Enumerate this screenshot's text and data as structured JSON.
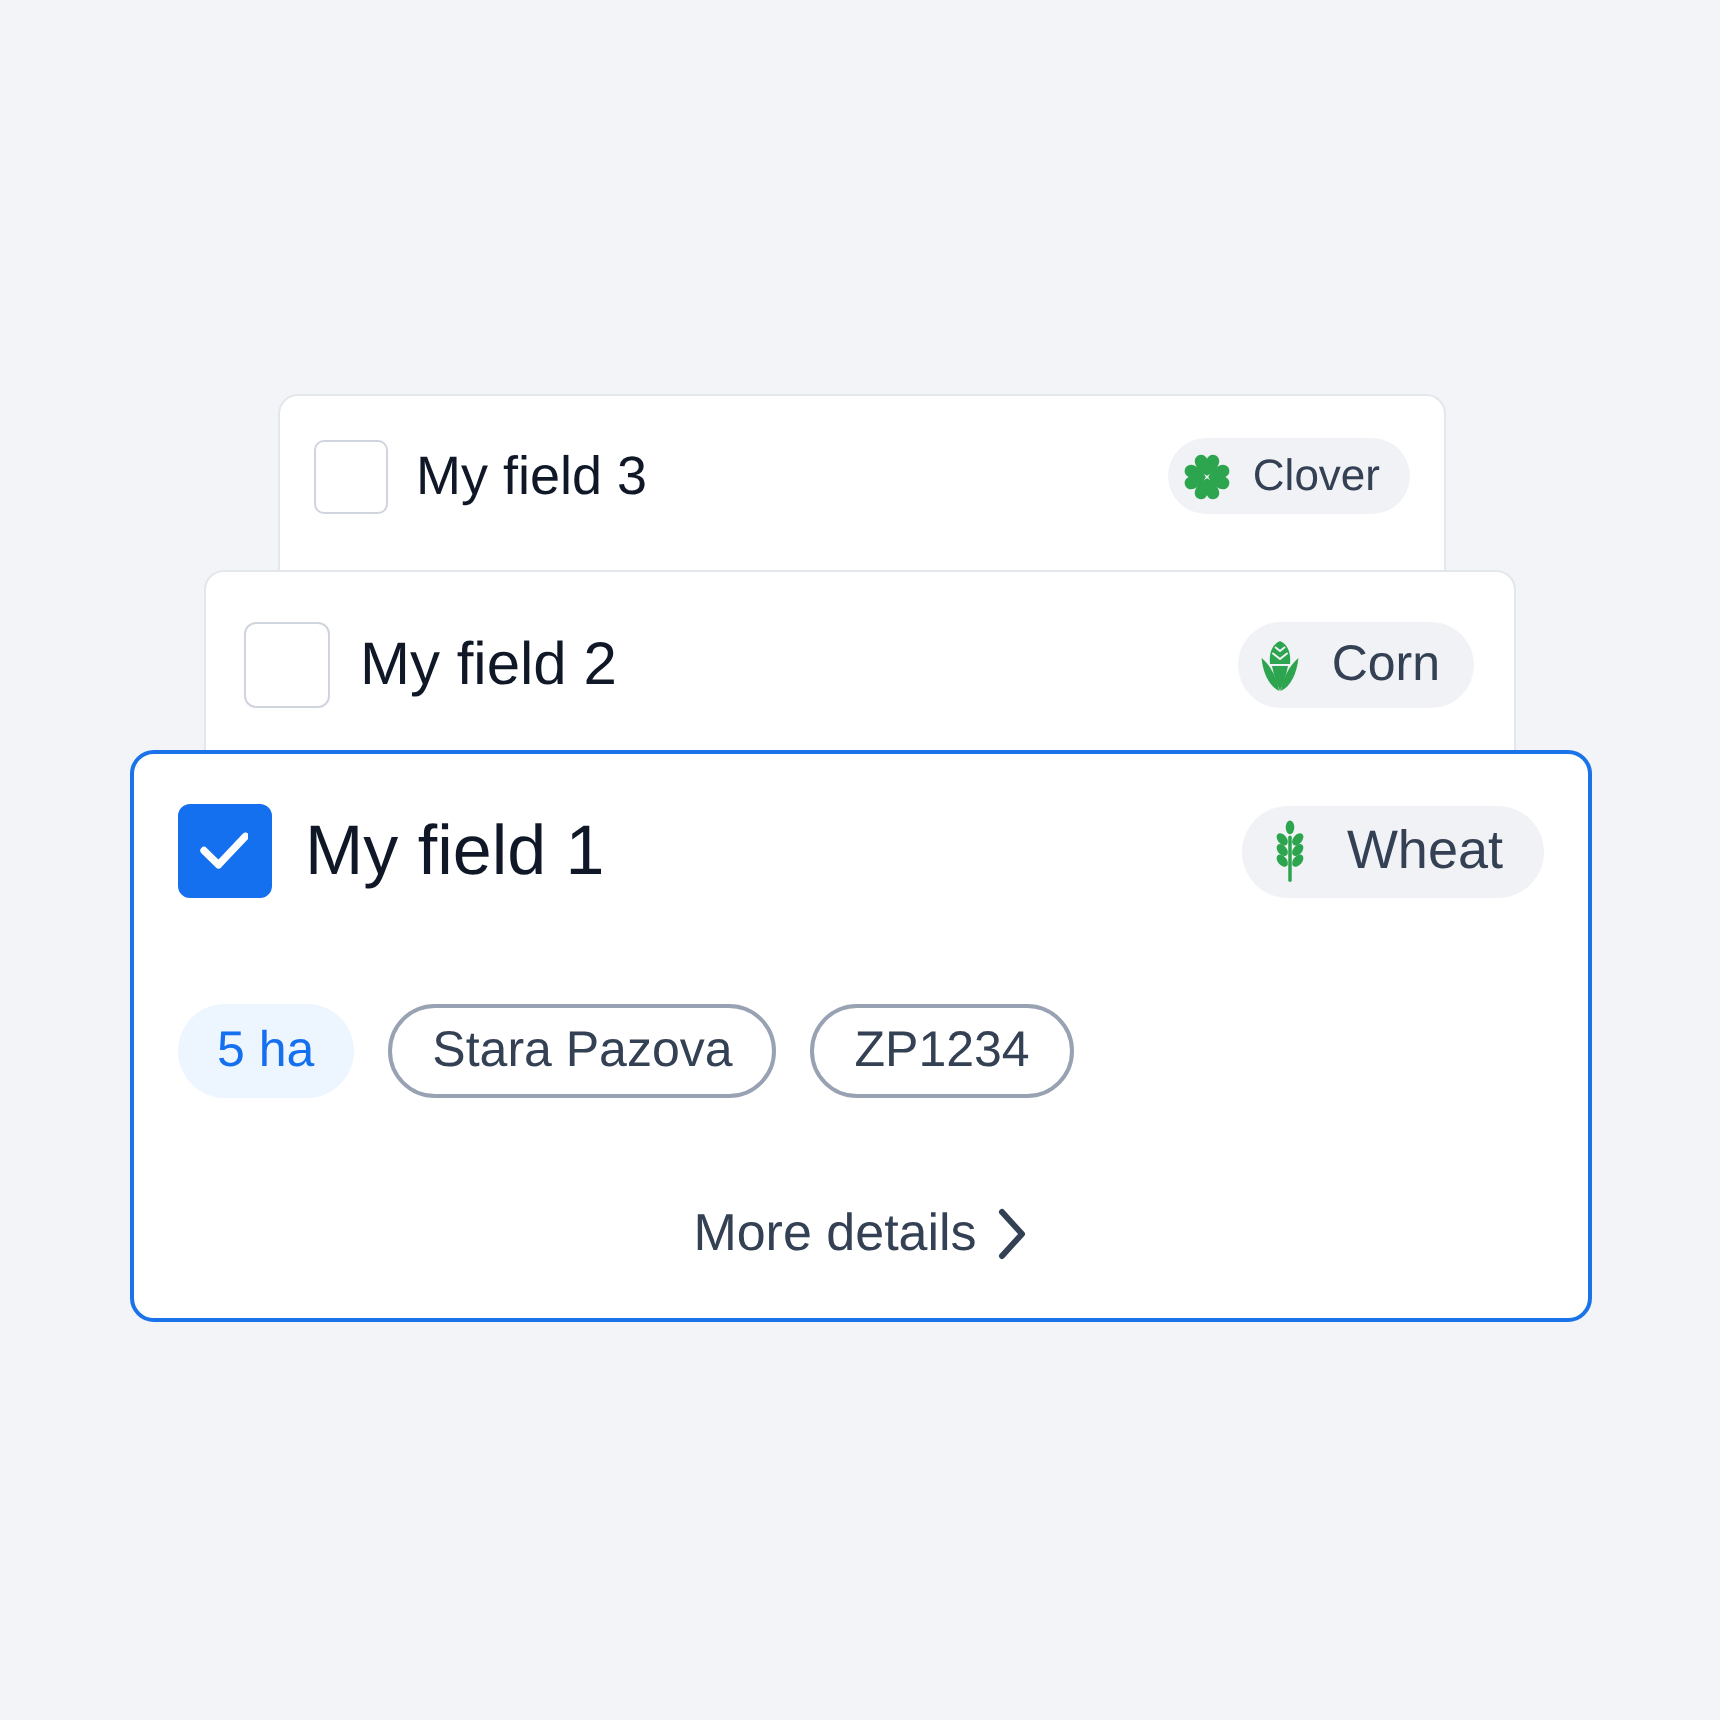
{
  "cards": [
    {
      "title": "My field 3",
      "checked": false,
      "crop": {
        "kind": "clover",
        "label": "Clover"
      }
    },
    {
      "title": "My field 2",
      "checked": false,
      "crop": {
        "kind": "corn",
        "label": "Corn"
      }
    },
    {
      "title": "My field 1",
      "checked": true,
      "crop": {
        "kind": "wheat",
        "label": "Wheat"
      },
      "tags": [
        {
          "kind": "area",
          "label": "5 ha"
        },
        {
          "kind": "outline",
          "label": "Stara Pazova"
        },
        {
          "kind": "outline",
          "label": "ZP1234"
        }
      ],
      "link": "More details"
    }
  ]
}
